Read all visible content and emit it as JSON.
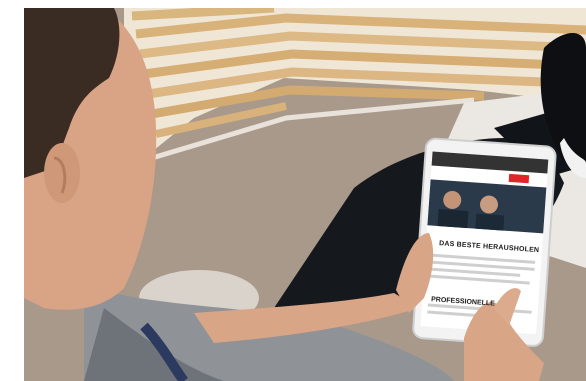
{
  "image": {
    "tablet_screen": {
      "headline": "DAS BESTE HERAUSHOLEN",
      "subheadline": "PROFESSIONELLE",
      "accent_color": "#e0262b"
    }
  }
}
